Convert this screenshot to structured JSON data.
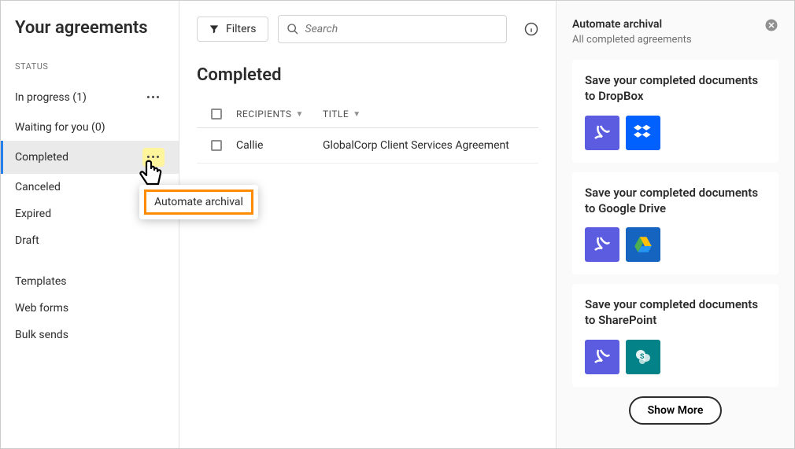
{
  "sidebar": {
    "title": "Your agreements",
    "section_label": "STATUS",
    "items": [
      {
        "label": "In progress (1)",
        "has_more": true,
        "active": false
      },
      {
        "label": "Waiting for you (0)",
        "has_more": false,
        "active": false
      },
      {
        "label": "Completed",
        "has_more": true,
        "active": true,
        "more_highlighted": true
      },
      {
        "label": "Canceled",
        "has_more": false,
        "active": false
      },
      {
        "label": "Expired",
        "has_more": false,
        "active": false
      },
      {
        "label": "Draft",
        "has_more": false,
        "active": false
      }
    ],
    "items2": [
      {
        "label": "Templates"
      },
      {
        "label": "Web forms"
      },
      {
        "label": "Bulk sends"
      }
    ]
  },
  "toolbar": {
    "filters_label": "Filters",
    "search_placeholder": "Search"
  },
  "content": {
    "title": "Completed",
    "headers": {
      "recipients": "RECIPIENTS",
      "title": "TITLE"
    },
    "rows": [
      {
        "recipient": "Callie",
        "title": "GlobalCorp Client Services Agreement"
      }
    ]
  },
  "popover": {
    "item": "Automate archival"
  },
  "panel": {
    "title": "Automate archival",
    "subtitle": "All completed agreements",
    "cards": [
      {
        "title": "Save your completed documents to DropBox",
        "icons": [
          "acrobat",
          "dropbox"
        ]
      },
      {
        "title": "Save your completed documents to Google Drive",
        "icons": [
          "acrobat",
          "gdrive"
        ]
      },
      {
        "title": "Save your completed documents to SharePoint",
        "icons": [
          "acrobat",
          "sharepoint"
        ]
      }
    ],
    "show_more": "Show More"
  }
}
